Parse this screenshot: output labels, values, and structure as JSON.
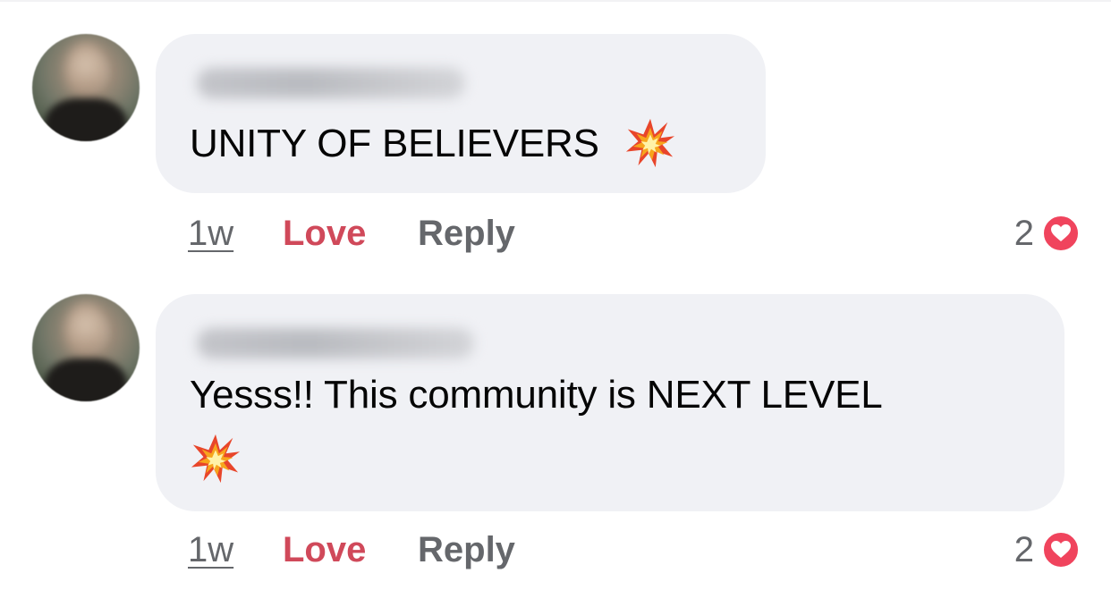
{
  "comments": [
    {
      "text": "UNITY OF BELIEVERS",
      "emoji": "collision-burst",
      "time": "1w",
      "love_label": "Love",
      "reply_label": "Reply",
      "reaction_count": "2",
      "reaction_type": "heart-icon"
    },
    {
      "text_line1": "Yesss!! This community is NEXT LEVEL",
      "emoji": "collision-burst",
      "time": "1w",
      "love_label": "Love",
      "reply_label": "Reply",
      "reaction_count": "2",
      "reaction_type": "heart-icon"
    }
  ],
  "colors": {
    "bubble": "#f0f1f5",
    "love_active": "#d0495a",
    "muted": "#65676b",
    "heart": "#f0445d"
  }
}
